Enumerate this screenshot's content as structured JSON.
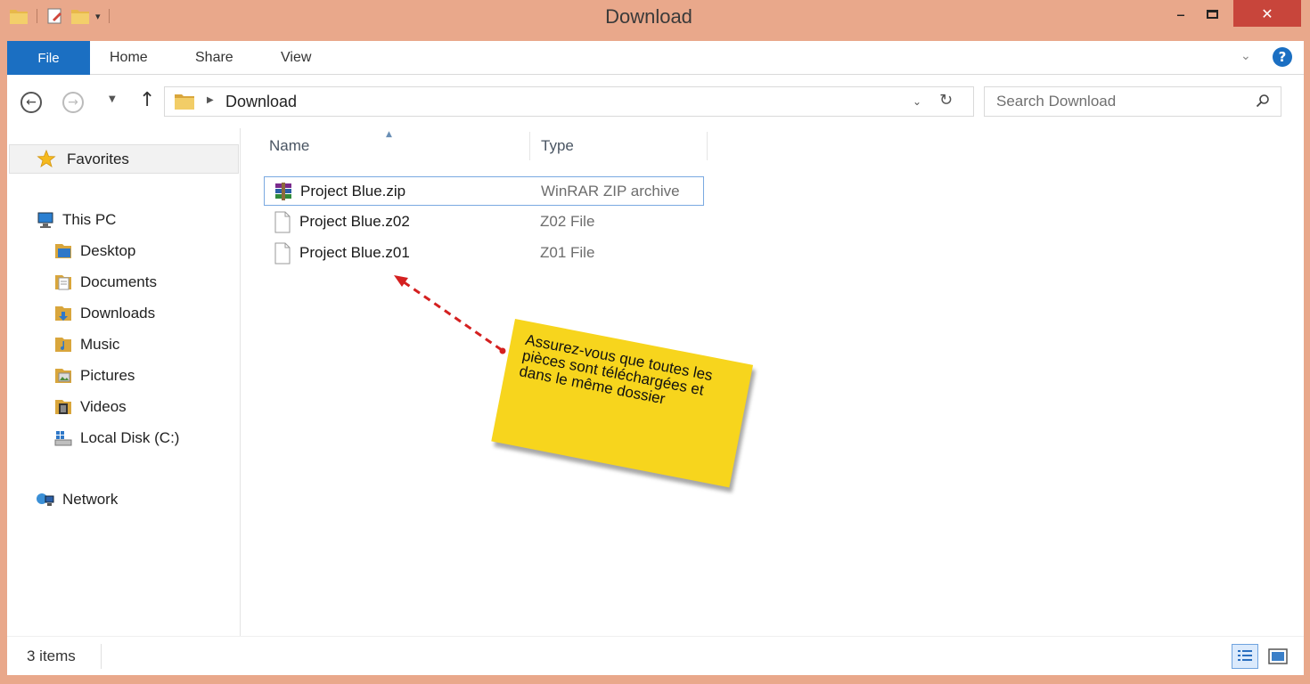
{
  "window": {
    "title": "Download",
    "minimize_label": "–",
    "close_label": "✕"
  },
  "ribbon": {
    "tabs": [
      {
        "label": "File"
      },
      {
        "label": "Home"
      },
      {
        "label": "Share"
      },
      {
        "label": "View"
      }
    ],
    "help_label": "?"
  },
  "address": {
    "breadcrumb": "Download",
    "search_placeholder": "Search Download"
  },
  "navigation": {
    "favorites": "Favorites",
    "this_pc": "This PC",
    "items": [
      {
        "label": "Desktop",
        "icon": "desktop-icon"
      },
      {
        "label": "Documents",
        "icon": "documents-icon"
      },
      {
        "label": "Downloads",
        "icon": "downloads-icon"
      },
      {
        "label": "Music",
        "icon": "music-icon"
      },
      {
        "label": "Pictures",
        "icon": "pictures-icon"
      },
      {
        "label": "Videos",
        "icon": "videos-icon"
      },
      {
        "label": "Local Disk (C:)",
        "icon": "local-disk-icon"
      }
    ],
    "network": "Network"
  },
  "file_list": {
    "columns": [
      "Name",
      "Type"
    ],
    "rows": [
      {
        "name": "Project Blue.zip",
        "type": "WinRAR ZIP archive",
        "icon": "winrar-archive-icon",
        "selected": true
      },
      {
        "name": "Project Blue.z02",
        "type": "Z02 File",
        "icon": "blank-file-icon"
      },
      {
        "name": "Project Blue.z01",
        "type": "Z01 File",
        "icon": "blank-file-icon"
      }
    ]
  },
  "annotation": {
    "text": "Assurez-vous que toutes les pièces sont téléchargées et dans le même dossier",
    "color": "#f7d51d",
    "arrow_color": "#d42020"
  },
  "status": {
    "item_count": "3 items"
  },
  "colors": {
    "frame": "#e9a88b",
    "accent": "#1b6fc2",
    "close": "#c8453b"
  }
}
